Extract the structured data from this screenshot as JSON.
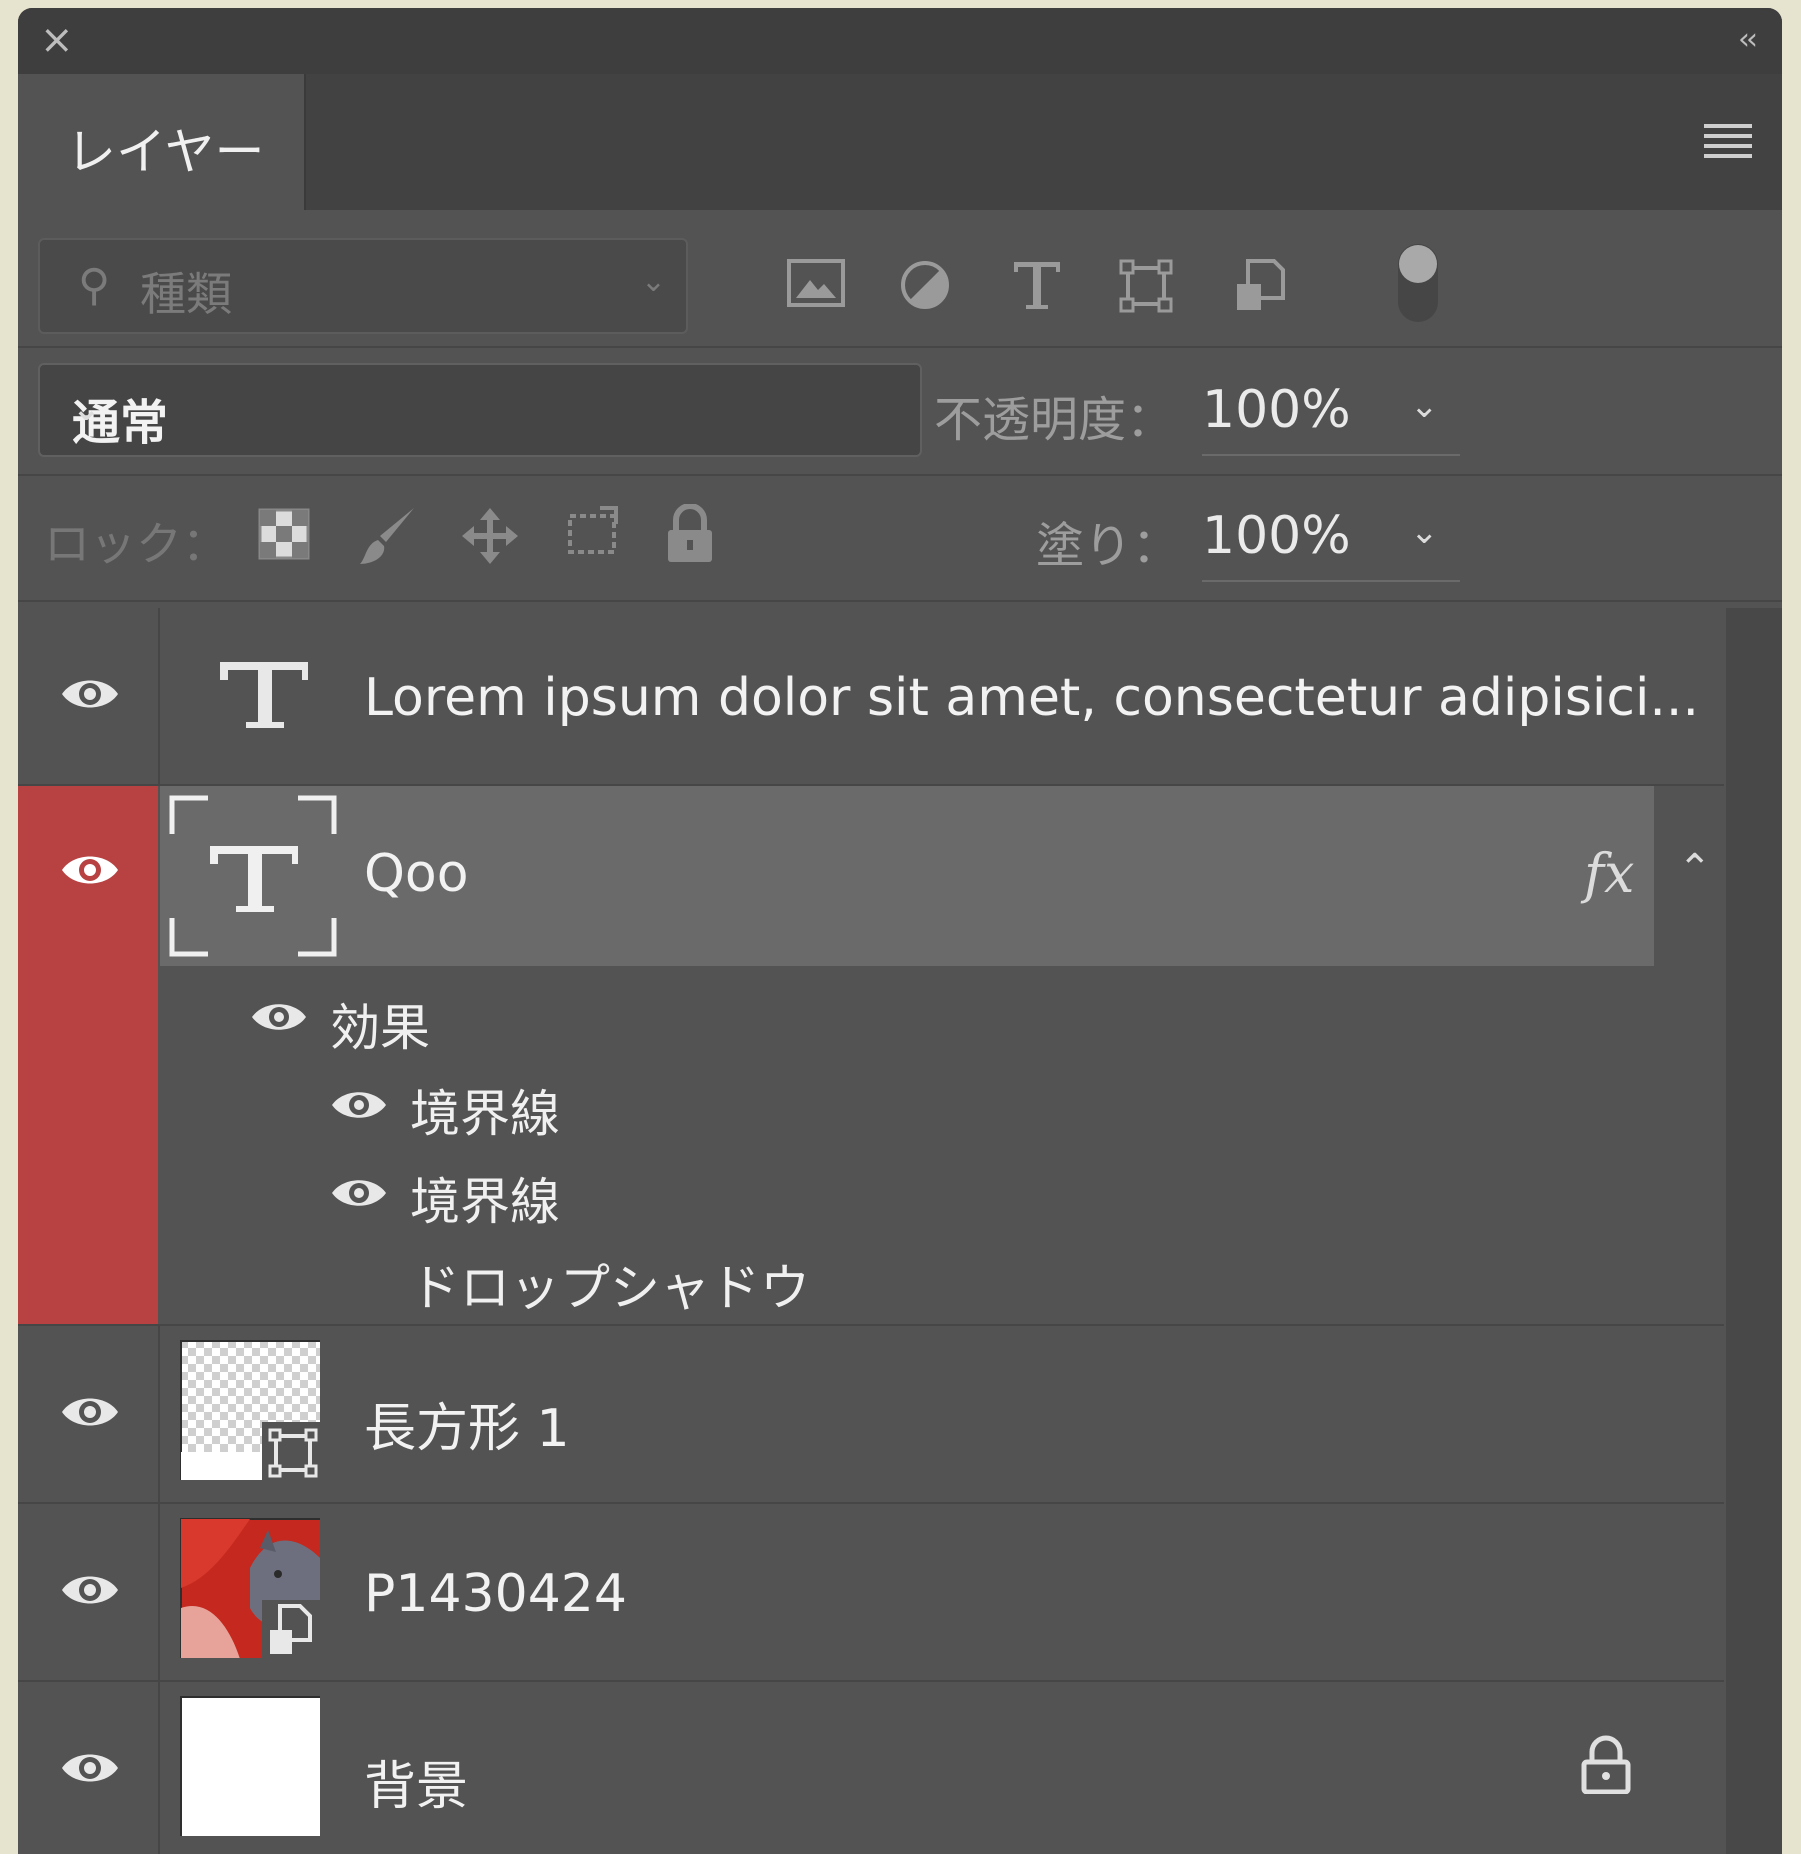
{
  "panel": {
    "close_label": "×",
    "collapse_label": "‹‹",
    "tab_label": "レイヤー"
  },
  "filter": {
    "placeholder": "種類",
    "icons": [
      "image-filter-icon",
      "adjustment-filter-icon",
      "type-filter-icon",
      "shape-filter-icon",
      "smart-object-filter-icon"
    ]
  },
  "blend": {
    "mode": "通常",
    "opacity_label": "不透明度：",
    "opacity_value": "100%"
  },
  "lock": {
    "label": "ロック：",
    "fill_label": "塗り：",
    "fill_value": "100%"
  },
  "layers": [
    {
      "name": "Lorem ipsum dolor sit amet, consectetur adipisici...",
      "kind": "text"
    },
    {
      "name": "Qoo",
      "kind": "text",
      "selected": true,
      "fx": "fx",
      "effects_label": "効果",
      "effects": [
        "境界線",
        "境界線",
        "ドロップシャドウ"
      ]
    },
    {
      "name": "長方形 1",
      "kind": "shape"
    },
    {
      "name": "P1430424",
      "kind": "smart-object"
    },
    {
      "name": "背景",
      "kind": "background",
      "locked": true
    }
  ],
  "colors": {
    "panel_bg": "#535353",
    "selection_red": "#b84242",
    "selected_row": "#6a6a6a"
  }
}
